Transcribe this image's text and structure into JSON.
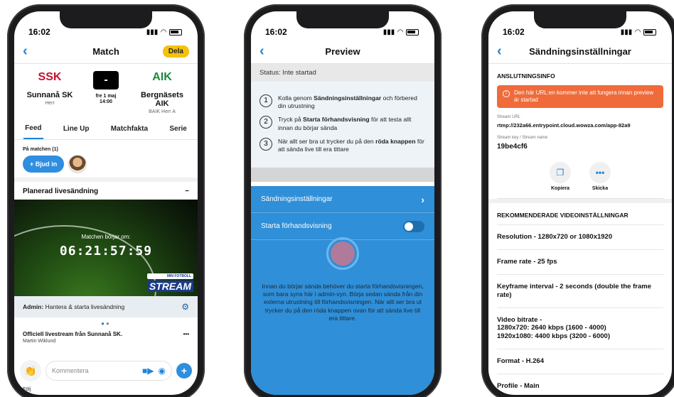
{
  "status_time": "16:02",
  "phone1": {
    "nav_title": "Match",
    "share_label": "Dela",
    "home_logo": "SSK",
    "home_team": "Sunnanå SK",
    "home_sub": "Herr",
    "score_value": "-",
    "match_date": "fre 1 maj",
    "match_time": "14:00",
    "away_logo": "AIK",
    "away_team": "Bergnäsets AIK",
    "away_sub": "BAIK Herr A",
    "tabs": [
      "Feed",
      "Line Up",
      "Matchfakta",
      "Serie"
    ],
    "attending_label": "På matchen (1)",
    "invite_label": "+ Bjud in",
    "live_title": "Planerad livesändning",
    "collapse_symbol": "−",
    "countdown_label": "Matchen börjar om:",
    "countdown": "06:21:57:59",
    "stream_small": "MIN FOTBOLL",
    "stream_big": "STREAM",
    "admin_bold": "Admin:",
    "admin_text": "Hantera & starta livesändning",
    "post_title": "Officiell livestream från Sunnanå SK.",
    "post_author": "Martin Wiklund",
    "post_more": "•••",
    "comment_placeholder": "Kommentera",
    "bottom_text": "Följ"
  },
  "phone2": {
    "nav_title": "Preview",
    "status_text": "Status: Inte startad",
    "steps": [
      {
        "num": "1",
        "pre": "Kolla genom ",
        "bold": "Sändningsinställningar",
        "post": " och förbered din utrustning"
      },
      {
        "num": "2",
        "pre": "Tryck på ",
        "bold": "Starta förhandsvisning",
        "post": " för att testa allt innan du börjar sända"
      },
      {
        "num": "3",
        "pre": "När allt ser bra ut trycker du på den ",
        "bold": "röda knappen",
        "post": " för att sända live till era tittare"
      }
    ],
    "settings_label": "Sändningsinställningar",
    "preview_label": "Starta förhandsvisning",
    "info_text": "Innan du börjar sända behöver du starta förhandsvisningen, som bara syns här i admin-vyn. Börja sedan sända från din externa utrustning till förhandsvisningen. När allt ser bra ut trycker du på den röda knappen ovan för att sända live till era tittare."
  },
  "phone3": {
    "nav_title": "Sändningsinställningar",
    "section1": "ANSLUTNINGSINFO",
    "alert_text": "Den här URL:en kommer inte att fungera innan preview är startad",
    "url_label": "Stream URL",
    "url_value": "rtmp://232a66.entrypoint.cloud.wowza.com/app-82a9",
    "key_label": "Stream key / Stream name",
    "key_value": "19be4cf6",
    "copy_label": "Kopiera",
    "send_label": "Skicka",
    "section2": "REKOMMENDERADE VIDEOINSTÄLLNINGAR",
    "specs": [
      "Resolution - 1280x720 or 1080x1920",
      "Frame rate - 25 fps",
      "Keyframe interval - 2 seconds (double the frame rate)",
      "Video bitrate -\n1280x720: 2640 kbps (1600 - 4000)\n1920x1080: 4400 kbps (3200 - 6000)",
      "Format - H.264",
      "Profile - Main"
    ]
  }
}
